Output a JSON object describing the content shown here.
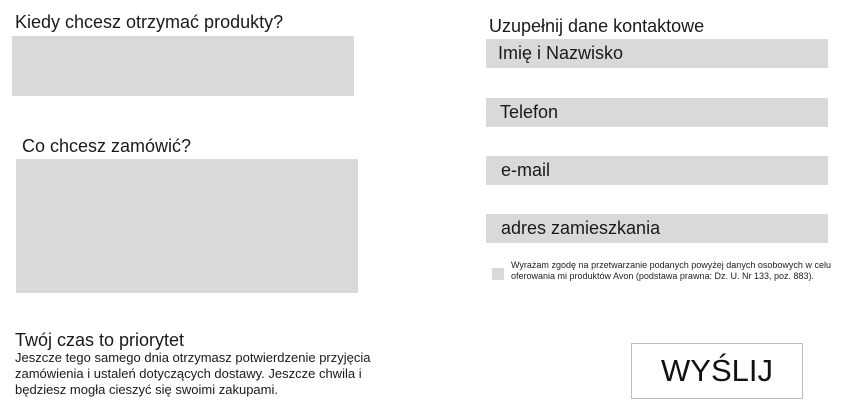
{
  "left": {
    "when_label": "Kiedy chcesz otrzymać produkty?",
    "what_label": "Co chcesz zamówić?"
  },
  "contact": {
    "heading": "Uzupełnij dane kontaktowe",
    "fields": [
      {
        "placeholder": "Imię i Nazwisko"
      },
      {
        "placeholder": "Telefon"
      },
      {
        "placeholder": "e-mail"
      },
      {
        "placeholder": "adres zamieszkania"
      }
    ],
    "consent": "Wyrażam zgodę na przetwarzanie podanych powyżej danych osobowych w celu oferowania mi produktów Avon (podstawa prawna: Dz. U. Nr 133, poz. 883)."
  },
  "info": {
    "title": "Twój czas to priorytet",
    "body": "Jeszcze tego samego dnia otrzymasz potwierdzenie przyjęcia zamówienia i ustaleń dotyczących dostawy. Jeszcze chwila i będziesz mogła cieszyć się swoimi zakupami."
  },
  "submit": {
    "label": "WYŚLIJ"
  },
  "colors": {
    "field_bg": "#d9d9d9",
    "button_border": "#bdbdbd"
  }
}
